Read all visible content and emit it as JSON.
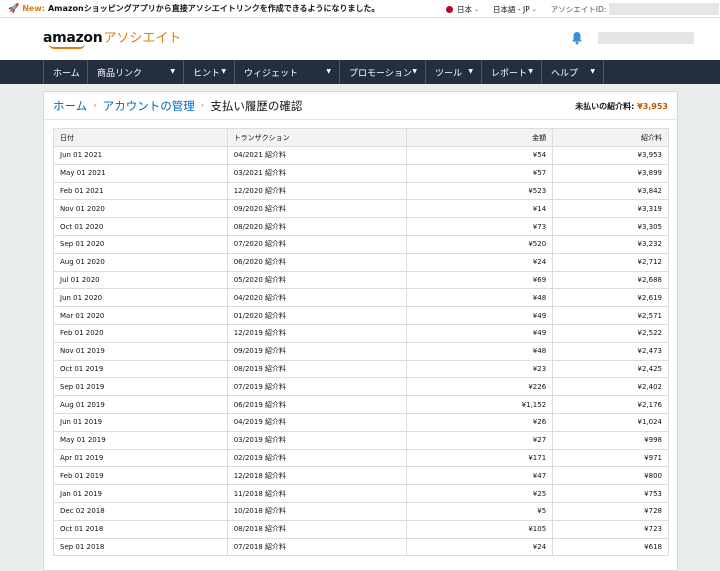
{
  "topbar": {
    "new_label": "New:",
    "message": "Amazonショッピングアプリから直接アソシエイトリンクを作成できるようになりました。",
    "country": "日本",
    "language": "日本語 - JP",
    "associate_id_label": "アソシエイトID:"
  },
  "header": {
    "logo_brand": "amazon",
    "logo_product": "アソシエイト"
  },
  "nav": {
    "items": [
      {
        "label": "ホーム"
      },
      {
        "label": "商品リンク"
      },
      {
        "label": "ヒント"
      },
      {
        "label": "ウィジェット"
      },
      {
        "label": "プロモーション"
      },
      {
        "label": "ツール"
      },
      {
        "label": "レポート"
      },
      {
        "label": "ヘルプ"
      }
    ]
  },
  "breadcrumb": {
    "home": "ホーム",
    "account": "アカウントの管理",
    "current": "支払い履歴の確認"
  },
  "unpaid": {
    "label": "未払いの紹介料:",
    "amount": "¥3,953"
  },
  "table": {
    "headers": [
      "日付",
      "トランザクション",
      "金額",
      "紹介料"
    ],
    "rows": [
      [
        "Jun 01 2021",
        "04/2021 紹介料",
        "¥54",
        "¥3,953"
      ],
      [
        "May 01 2021",
        "03/2021 紹介料",
        "¥57",
        "¥3,899"
      ],
      [
        "Feb 01 2021",
        "12/2020 紹介料",
        "¥523",
        "¥3,842"
      ],
      [
        "Nov 01 2020",
        "09/2020 紹介料",
        "¥14",
        "¥3,319"
      ],
      [
        "Oct 01 2020",
        "08/2020 紹介料",
        "¥73",
        "¥3,305"
      ],
      [
        "Sep 01 2020",
        "07/2020 紹介料",
        "¥520",
        "¥3,232"
      ],
      [
        "Aug 01 2020",
        "06/2020 紹介料",
        "¥24",
        "¥2,712"
      ],
      [
        "Jul 01 2020",
        "05/2020 紹介料",
        "¥69",
        "¥2,688"
      ],
      [
        "Jun 01 2020",
        "04/2020 紹介料",
        "¥48",
        "¥2,619"
      ],
      [
        "Mar 01 2020",
        "01/2020 紹介料",
        "¥49",
        "¥2,571"
      ],
      [
        "Feb 01 2020",
        "12/2019 紹介料",
        "¥49",
        "¥2,522"
      ],
      [
        "Nov 01 2019",
        "09/2019 紹介料",
        "¥48",
        "¥2,473"
      ],
      [
        "Oct 01 2019",
        "08/2019 紹介料",
        "¥23",
        "¥2,425"
      ],
      [
        "Sep 01 2019",
        "07/2019 紹介料",
        "¥226",
        "¥2,402"
      ],
      [
        "Aug 01 2019",
        "06/2019 紹介料",
        "¥1,152",
        "¥2,176"
      ],
      [
        "Jun 01 2019",
        "04/2019 紹介料",
        "¥26",
        "¥1,024"
      ],
      [
        "May 01 2019",
        "03/2019 紹介料",
        "¥27",
        "¥998"
      ],
      [
        "Apr 01 2019",
        "02/2019 紹介料",
        "¥171",
        "¥971"
      ],
      [
        "Feb 01 2019",
        "12/2018 紹介料",
        "¥47",
        "¥800"
      ],
      [
        "Jan 01 2019",
        "11/2018 紹介料",
        "¥25",
        "¥753"
      ],
      [
        "Dec 02 2018",
        "10/2018 紹介料",
        "¥5",
        "¥728"
      ],
      [
        "Oct 01 2018",
        "08/2018 紹介料",
        "¥105",
        "¥723"
      ],
      [
        "Sep 01 2018",
        "07/2018 紹介料",
        "¥24",
        "¥618"
      ]
    ]
  },
  "colors": {
    "accent": "#e47911",
    "nav_bg": "#232f3e",
    "link": "#0066c0",
    "unpaid_amount": "#c45500"
  }
}
